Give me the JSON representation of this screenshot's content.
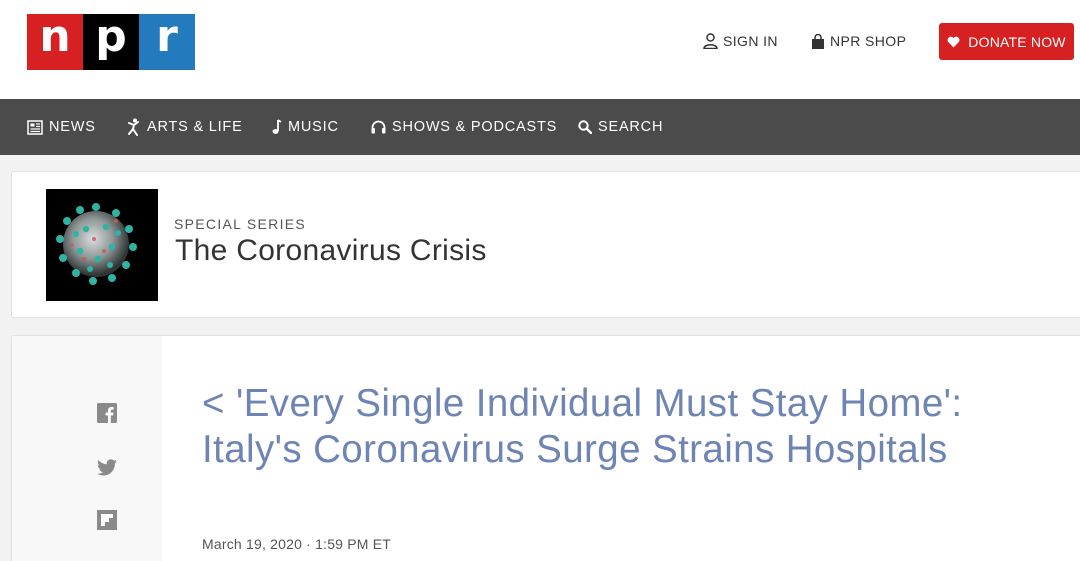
{
  "logo": {
    "letters": [
      "n",
      "p",
      "r"
    ]
  },
  "header": {
    "sign_in": "SIGN IN",
    "shop": "NPR SHOP",
    "donate": "DONATE NOW"
  },
  "nav": {
    "items": [
      {
        "label": "NEWS",
        "icon": "newspaper-icon"
      },
      {
        "label": "ARTS & LIFE",
        "icon": "dancer-icon"
      },
      {
        "label": "MUSIC",
        "icon": "music-note-icon"
      },
      {
        "label": "SHOWS & PODCASTS",
        "icon": "headphones-icon"
      },
      {
        "label": "SEARCH",
        "icon": "search-icon"
      }
    ]
  },
  "series": {
    "kicker": "SPECIAL SERIES",
    "title": "The Coronavirus Crisis"
  },
  "article": {
    "headline": "< 'Every Single Individual Must Stay Home': Italy's Coronavirus Surge Strains Hospitals",
    "date": "March 19, 2020 · 1:59 PM ET",
    "share_icons": [
      "facebook-icon",
      "twitter-icon",
      "flipboard-icon"
    ]
  },
  "colors": {
    "npr_red": "#d62021",
    "npr_blue": "#237bbd",
    "nav_bg": "#4b4b4b",
    "headline_link": "#6d84b4"
  }
}
